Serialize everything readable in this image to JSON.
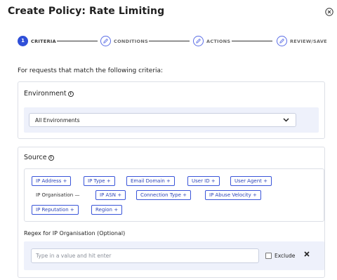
{
  "dialog": {
    "title": "Create Policy: Rate Limiting"
  },
  "stepper": {
    "steps": [
      {
        "number": "1",
        "label": "CRITERIA",
        "state": "active"
      },
      {
        "label": "CONDITIONS",
        "state": "todo"
      },
      {
        "label": "ACTIONS",
        "state": "todo"
      },
      {
        "label": "REVIEW/SAVE",
        "state": "todo"
      }
    ]
  },
  "intro_text": "For requests that match the following criteria:",
  "environment": {
    "title": "Environment",
    "selected": "All Environments"
  },
  "source": {
    "title": "Source",
    "chips": [
      {
        "label": "IP Address +"
      },
      {
        "label": "IP Type +"
      },
      {
        "label": "Email Domain +"
      },
      {
        "label": "User ID +"
      },
      {
        "label": "User Agent +"
      },
      {
        "label": "IP Organisation —"
      },
      {
        "label": "IP ASN +"
      },
      {
        "label": "Connection Type +"
      },
      {
        "label": "IP Abuse Velocity +"
      },
      {
        "label": "IP Reputation +"
      },
      {
        "label": "Region +"
      }
    ],
    "regex_label": "Regex for IP Organisation (Optional)",
    "regex_placeholder": "Type in a value and hit enter",
    "exclude_label": "Exclude"
  },
  "colors": {
    "accent": "#2f4fd8",
    "chip_border": "#3a55d9",
    "panel_bg": "#eef1fb"
  },
  "icons": [
    "close-icon",
    "pencil-icon",
    "info-icon",
    "chevron-down-icon",
    "remove-icon"
  ]
}
